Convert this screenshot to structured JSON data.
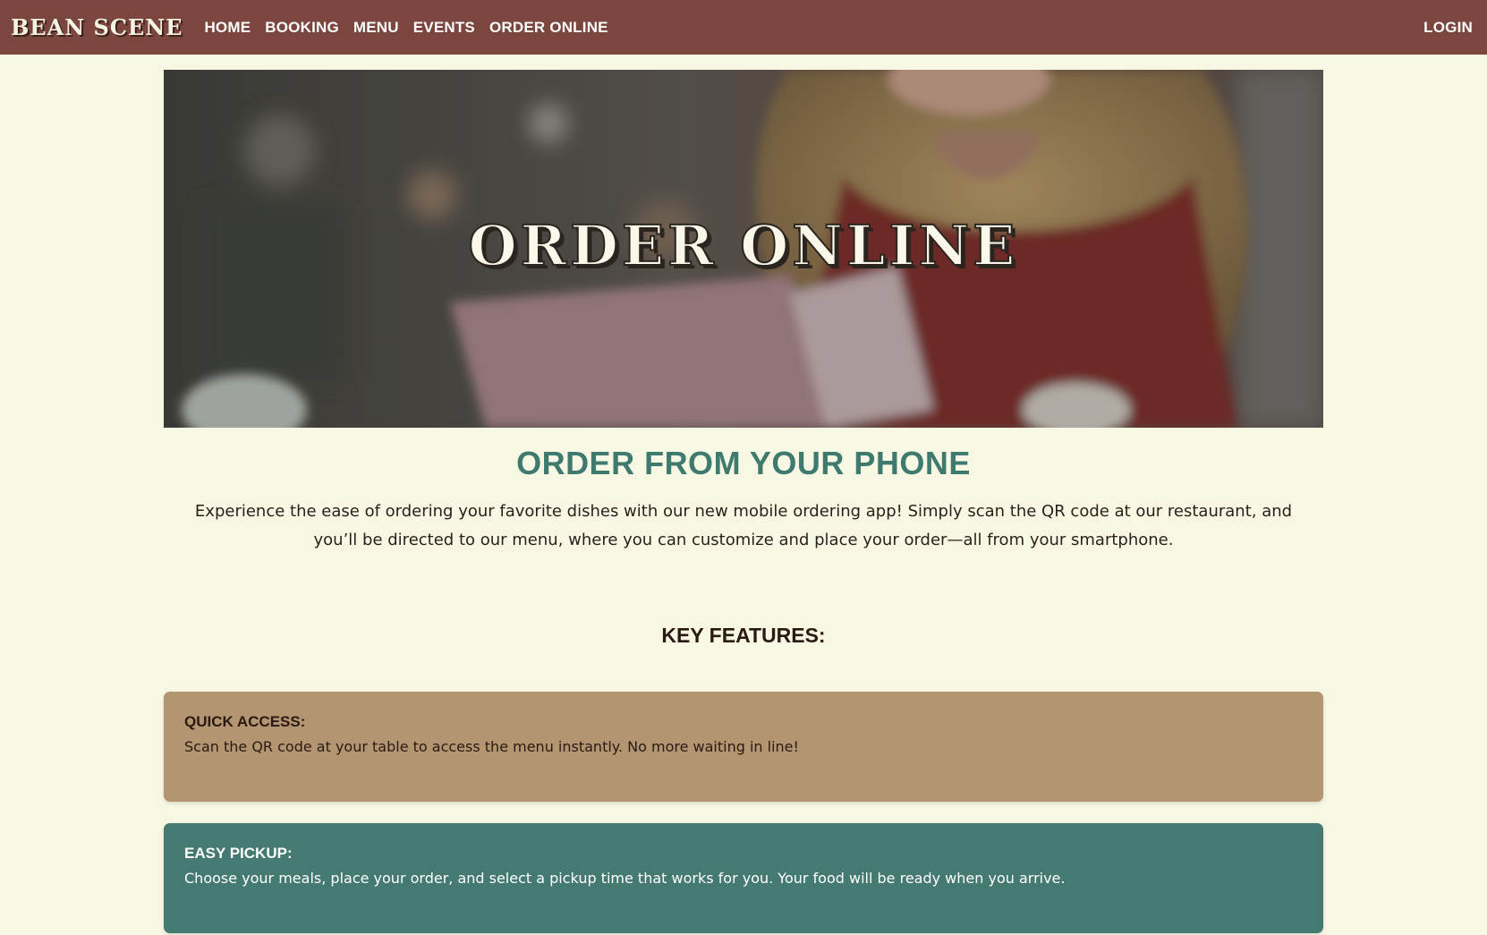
{
  "navbar": {
    "brand": "BEAN SCENE",
    "links": [
      "HOME",
      "BOOKING",
      "MENU",
      "EVENTS",
      "ORDER ONLINE"
    ],
    "login": "LOGIN",
    "background": "#7a463e"
  },
  "hero": {
    "title": "ORDER ONLINE"
  },
  "section": {
    "title": "ORDER FROM YOUR PHONE",
    "intro": "Experience the ease of ordering your favorite dishes with our new mobile ordering app! Simply scan the QR code at our restaurant, and you’ll be directed to our menu, where you can customize and place your order—all from your smartphone."
  },
  "features": {
    "heading": "KEY FEATURES:",
    "items": [
      {
        "title": "QUICK ACCESS:",
        "text": "Scan the QR code at your table to access the menu instantly. No more waiting in line!",
        "color": "#b39571"
      },
      {
        "title": "EASY PICKUP:",
        "text": "Choose your meals, place your order, and select a pickup time that works for you. Your food will be ready when you arrive.",
        "color": "#447a71"
      }
    ]
  },
  "colors": {
    "page_background": "#f7f7e4",
    "accent_teal": "#3f7a6f"
  }
}
